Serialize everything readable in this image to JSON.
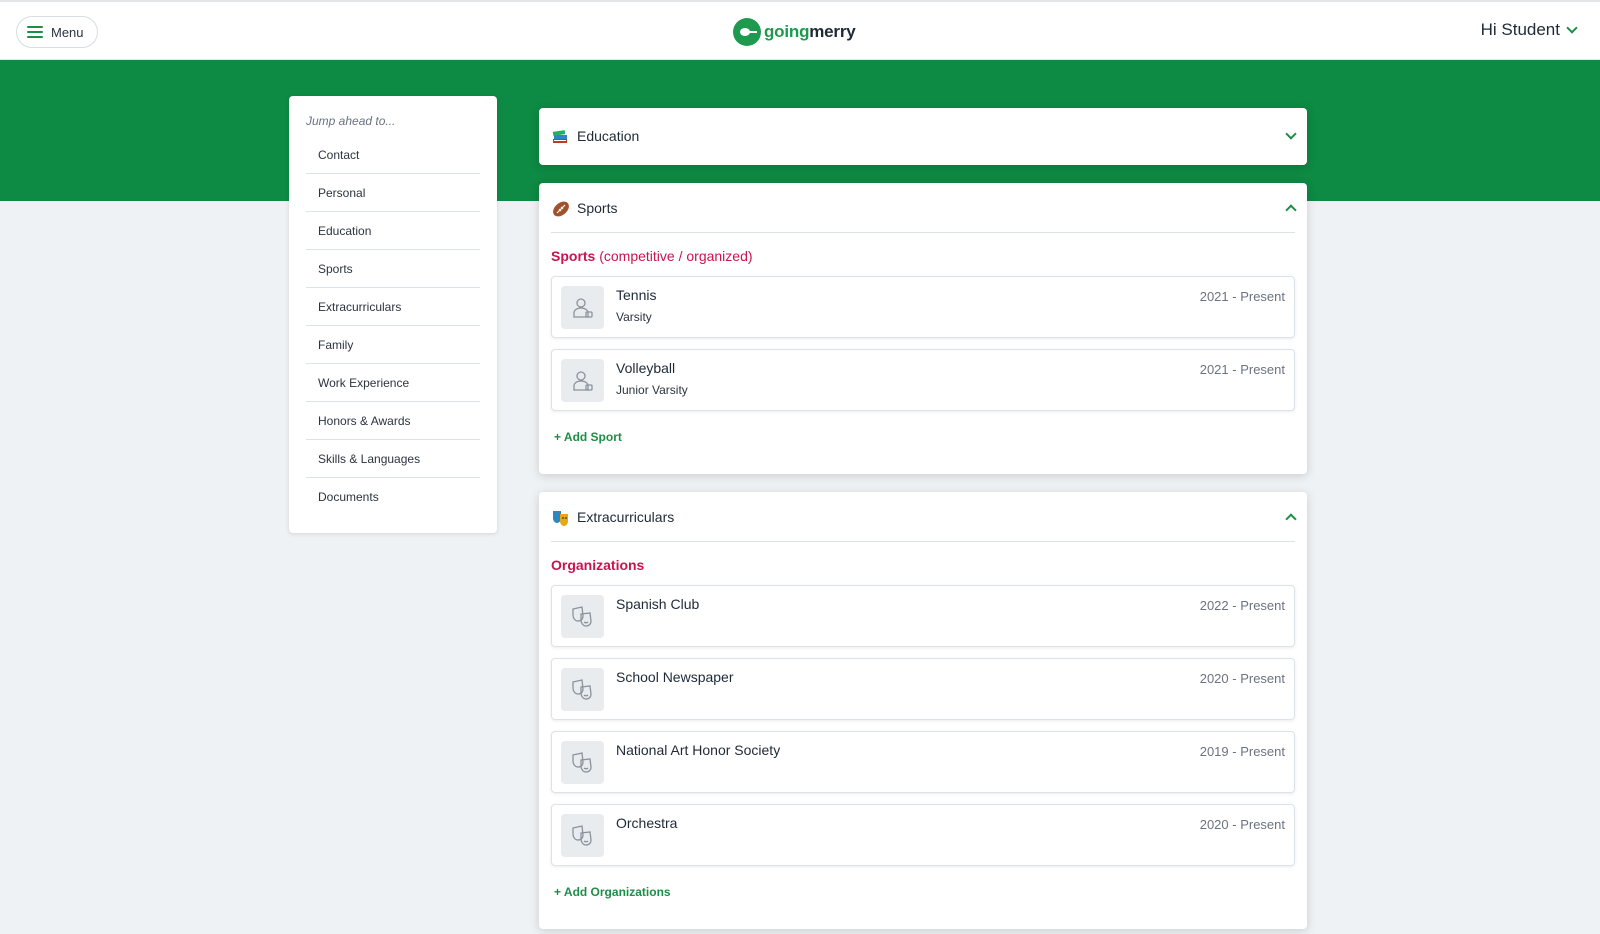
{
  "header": {
    "menu_label": "Menu",
    "logo_going": "going",
    "logo_merry": "merry",
    "user_greeting": "Hi Student"
  },
  "colors": {
    "brand_green": "#0d8a43",
    "accent_pink": "#c8144f",
    "link_green": "#1e8e47"
  },
  "sidebar": {
    "jump_label": "Jump ahead to...",
    "items": [
      {
        "label": "Contact"
      },
      {
        "label": "Personal"
      },
      {
        "label": "Education"
      },
      {
        "label": "Sports"
      },
      {
        "label": "Extracurriculars"
      },
      {
        "label": "Family"
      },
      {
        "label": "Work Experience"
      },
      {
        "label": "Honors & Awards"
      },
      {
        "label": "Skills & Languages"
      },
      {
        "label": "Documents"
      }
    ]
  },
  "education": {
    "title": "Education",
    "icon": "books-icon",
    "expanded": false
  },
  "sports": {
    "title": "Sports",
    "icon": "football-icon",
    "expanded": true,
    "section_title": "Sports",
    "section_subtitle": "(competitive / organized)",
    "items": [
      {
        "name": "Tennis",
        "level": "Varsity",
        "dates": "2021 - Present",
        "icon": "athlete-icon"
      },
      {
        "name": "Volleyball",
        "level": "Junior Varsity",
        "dates": "2021 - Present",
        "icon": "athlete-icon"
      }
    ],
    "add_label": "+ Add Sport"
  },
  "extracurriculars": {
    "title": "Extracurriculars",
    "icon": "theater-masks-icon",
    "expanded": true,
    "section_title": "Organizations",
    "items": [
      {
        "name": "Spanish Club",
        "dates": "2022 - Present",
        "icon": "masks-icon"
      },
      {
        "name": "School Newspaper",
        "dates": "2020 - Present",
        "icon": "masks-icon"
      },
      {
        "name": "National Art Honor Society",
        "dates": "2019 - Present",
        "icon": "masks-icon"
      },
      {
        "name": "Orchestra",
        "dates": "2020 - Present",
        "icon": "masks-icon"
      }
    ],
    "add_label": "+ Add Organizations"
  }
}
